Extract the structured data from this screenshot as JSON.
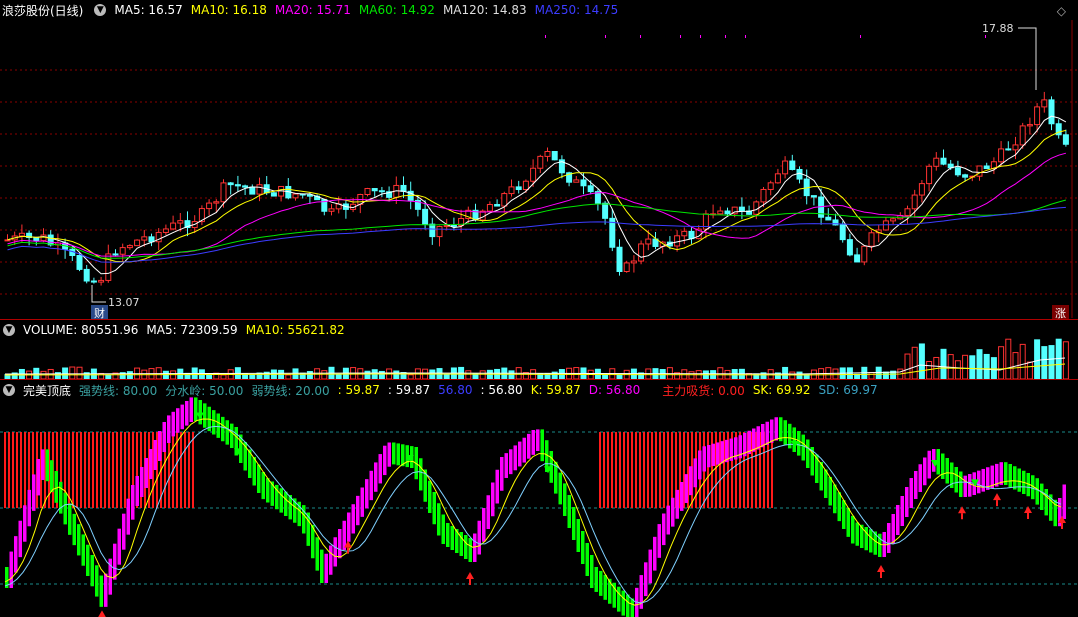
{
  "colors": {
    "up": "#ff3232",
    "down": "#54ffff",
    "ma5": "#ffffff",
    "ma10": "#ffff00",
    "ma20": "#ff00ff",
    "ma60": "#00e600",
    "ma120": "#cccccc",
    "ma250": "#3c3cff",
    "grid": "#8a0000",
    "magenta_bar": "#ff00ff",
    "green_bar": "#00ff00"
  },
  "main": {
    "title": "浪莎股份(日线)",
    "ma5": "MA5: 16.57",
    "ma10": "MA10: 16.18",
    "ma20": "MA20: 15.71",
    "ma60": "MA60: 14.92",
    "ma120": "MA120: 14.83",
    "ma250": "MA250: 14.75",
    "high_label": "17.88",
    "low_label": "13.07",
    "cai_badge": "财",
    "zhang_badge": "涨",
    "options_icon": "diamond-icon"
  },
  "volume": {
    "label": "VOLUME: 80551.96",
    "ma5": "MA5: 72309.59",
    "ma10": "MA10: 55621.82"
  },
  "indicator": {
    "name": "完美顶底",
    "strong": "强势线: 80.00",
    "divide": "分水岭: 50.00",
    "weak": "弱势线: 20.00",
    "v1": ": 59.87",
    "v2": ": 59.87",
    "v3": "56.80",
    "v4": ": 56.80",
    "k": "K: 59.87",
    "d": "D: 56.80",
    "flow": "主力吸货: 0.00",
    "sk": "SK: 69.92",
    "sd": "SD: 69.97"
  }
}
